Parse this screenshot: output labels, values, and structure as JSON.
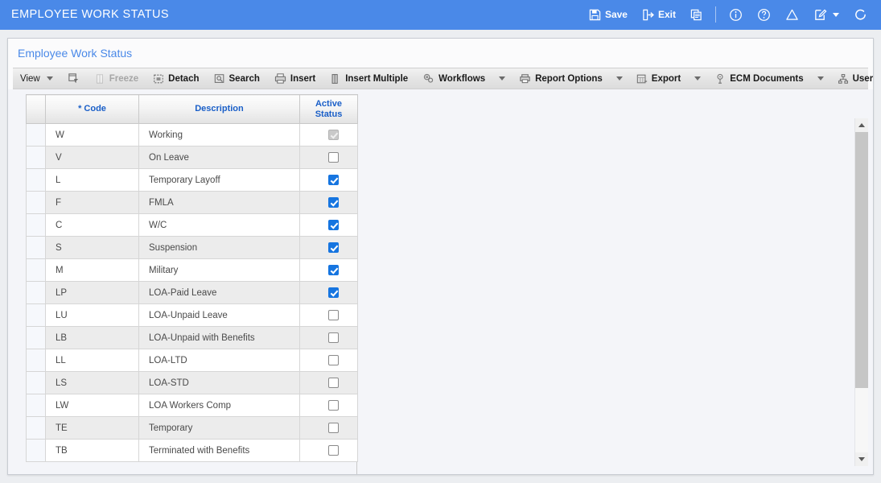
{
  "titlebar": {
    "title": "EMPLOYEE WORK STATUS",
    "save_label": "Save",
    "exit_label": "Exit",
    "accent_color": "#4a89e8",
    "icons": {
      "save": "save-icon",
      "exit": "exit-icon",
      "copy": "copy-window-icon",
      "info": "info-icon",
      "help": "help-icon",
      "warning": "warning-icon",
      "edit": "edit-note-icon",
      "refresh": "refresh-icon"
    }
  },
  "card": {
    "title": "Employee Work Status"
  },
  "toolbar": {
    "items": [
      {
        "label": "View",
        "icon": "",
        "caret": true,
        "disabled": false,
        "bold": false
      },
      {
        "label": "",
        "icon": "detach-filter-icon",
        "caret": false,
        "disabled": false,
        "bold": true
      },
      {
        "label": "Freeze",
        "icon": "freeze-icon",
        "caret": false,
        "disabled": true,
        "bold": true
      },
      {
        "label": "Detach",
        "icon": "detach-icon",
        "caret": false,
        "disabled": false,
        "bold": true
      },
      {
        "label": "Search",
        "icon": "search-icon",
        "caret": false,
        "disabled": false,
        "bold": true
      },
      {
        "label": "Insert",
        "icon": "insert-icon",
        "caret": false,
        "disabled": false,
        "bold": true
      },
      {
        "label": "Insert Multiple",
        "icon": "insert-multiple-icon",
        "caret": false,
        "disabled": false,
        "bold": true
      },
      {
        "label": "Workflows",
        "icon": "workflows-icon",
        "caret": true,
        "disabled": false,
        "bold": true
      },
      {
        "label": "Report Options",
        "icon": "report-options-icon",
        "caret": true,
        "disabled": false,
        "bold": true
      },
      {
        "label": "Export",
        "icon": "export-icon",
        "caret": true,
        "disabled": false,
        "bold": true
      },
      {
        "label": "ECM Documents",
        "icon": "ecm-documents-icon",
        "caret": true,
        "disabled": false,
        "bold": true
      },
      {
        "label": "User Extensions",
        "icon": "user-extensions-icon",
        "caret": false,
        "disabled": false,
        "bold": true
      }
    ]
  },
  "grid": {
    "columns": [
      {
        "key": "handle",
        "label": ""
      },
      {
        "key": "code",
        "label": "* Code"
      },
      {
        "key": "description",
        "label": "Description"
      },
      {
        "key": "active_status",
        "label": "Active\nStatus",
        "line1": "Active",
        "line2": "Status"
      }
    ],
    "header_color": "#1a5fc8",
    "rows": [
      {
        "code": "W",
        "description": "Working",
        "active": true,
        "readonly": true
      },
      {
        "code": "V",
        "description": "On Leave",
        "active": false,
        "readonly": false
      },
      {
        "code": "L",
        "description": "Temporary Layoff",
        "active": true,
        "readonly": false
      },
      {
        "code": "F",
        "description": "FMLA",
        "active": true,
        "readonly": false
      },
      {
        "code": "C",
        "description": "W/C",
        "active": true,
        "readonly": false
      },
      {
        "code": "S",
        "description": "Suspension",
        "active": true,
        "readonly": false
      },
      {
        "code": "M",
        "description": "Military",
        "active": true,
        "readonly": false
      },
      {
        "code": "LP",
        "description": "LOA-Paid Leave",
        "active": true,
        "readonly": false
      },
      {
        "code": "LU",
        "description": "LOA-Unpaid Leave",
        "active": false,
        "readonly": false
      },
      {
        "code": "LB",
        "description": "LOA-Unpaid with Benefits",
        "active": false,
        "readonly": false
      },
      {
        "code": "LL",
        "description": "LOA-LTD",
        "active": false,
        "readonly": false
      },
      {
        "code": "LS",
        "description": "LOA-STD",
        "active": false,
        "readonly": false
      },
      {
        "code": "LW",
        "description": "LOA Workers Comp",
        "active": false,
        "readonly": false
      },
      {
        "code": "TE",
        "description": "Temporary",
        "active": false,
        "readonly": false
      },
      {
        "code": "TB",
        "description": "Terminated with Benefits",
        "active": false,
        "readonly": false
      }
    ]
  },
  "scrollbar": {
    "up_icon": "chevron-up-icon",
    "down_icon": "chevron-down-icon",
    "thumb_percent": 80
  }
}
